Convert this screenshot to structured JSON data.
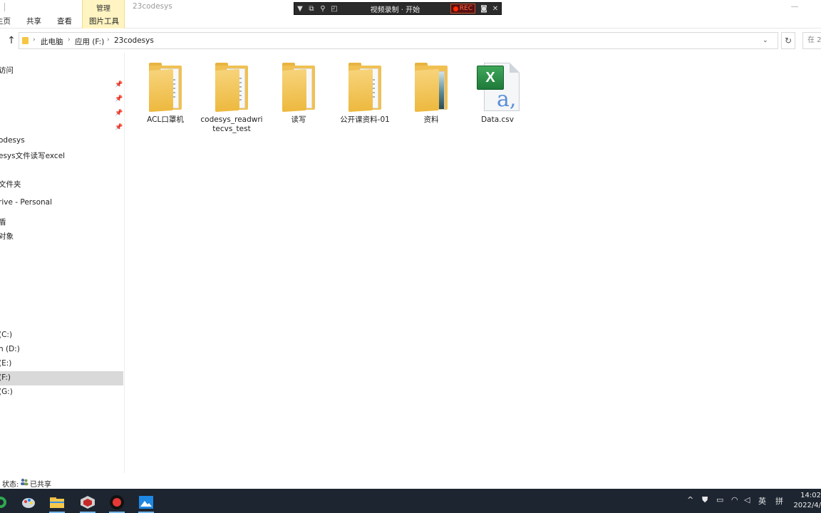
{
  "ribbon": {
    "tabs": [
      "主页",
      "共享",
      "查看",
      "图片工具"
    ],
    "context_label": "管理",
    "window_title": "23codesys"
  },
  "recorder": {
    "title": "视频录制 · 开始",
    "rec_label": "REC"
  },
  "address": {
    "crumbs": [
      "此电脑",
      "应用 (F:)",
      "23codesys"
    ],
    "search_placeholder": "在 2"
  },
  "sidebar": {
    "items": [
      {
        "label": "访问"
      },
      {
        "label": "odesys"
      },
      {
        "label": "esys文件读写excel"
      },
      {
        "label": "文件夹"
      },
      {
        "label": "rive - Personal"
      },
      {
        "label": "盾"
      },
      {
        "label": "对象"
      },
      {
        "label": " (C:)"
      },
      {
        "label": "n (D:)"
      },
      {
        "label": " (E:)"
      },
      {
        "label": " (F:)"
      },
      {
        "label": " (G:)"
      }
    ]
  },
  "files": [
    {
      "name": "ACL口罩机",
      "type": "folder"
    },
    {
      "name": "codesys_readwritecvs_test",
      "type": "folder"
    },
    {
      "name": "读写",
      "type": "folder"
    },
    {
      "name": "公开课资料-01",
      "type": "folder"
    },
    {
      "name": "资料",
      "type": "folder"
    },
    {
      "name": "Data.csv",
      "type": "excel"
    }
  ],
  "status": {
    "label": "状态:",
    "share": "已共享"
  },
  "taskbar": {
    "ime": "英",
    "ime2": "拼",
    "time": "14:02",
    "date": "2022/4/"
  },
  "colors": {
    "taskbar": "#1d2530",
    "selected": "#d9d9d9",
    "context_tab": "#fff4c2",
    "folder": "#f0c052"
  }
}
